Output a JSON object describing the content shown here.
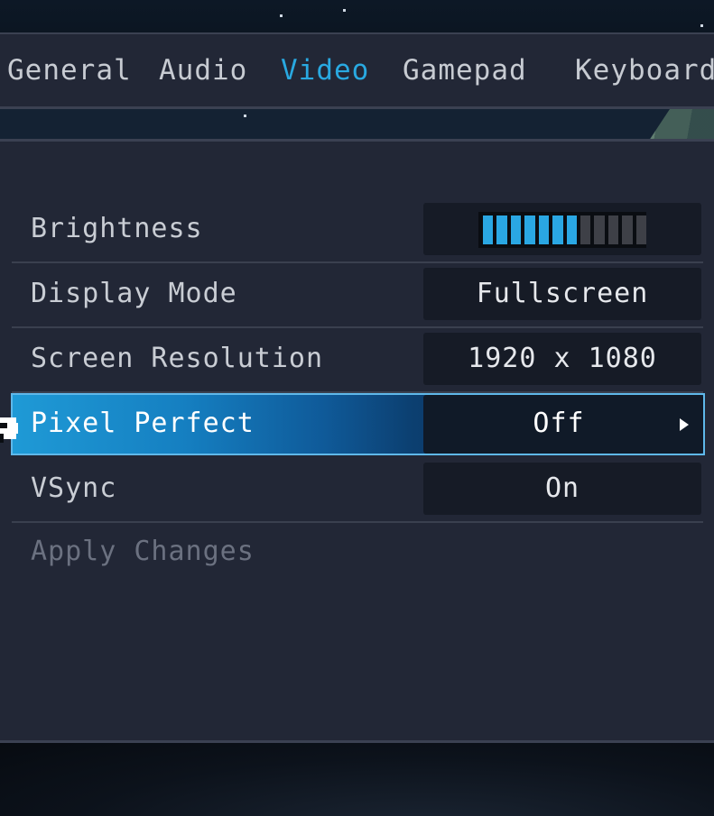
{
  "tabs": [
    {
      "label": "General",
      "active": false
    },
    {
      "label": "Audio",
      "active": false
    },
    {
      "label": "Video",
      "active": true
    },
    {
      "label": "Gamepad",
      "active": false
    },
    {
      "label": "Keyboard",
      "active": false
    }
  ],
  "settings": {
    "brightness": {
      "label": "Brightness",
      "level": 7,
      "max": 12
    },
    "display_mode": {
      "label": "Display Mode",
      "value": "Fullscreen"
    },
    "screen_resolution": {
      "label": "Screen Resolution",
      "value": "1920 x 1080"
    },
    "pixel_perfect": {
      "label": "Pixel Perfect",
      "value": "Off",
      "selected": true
    },
    "vsync": {
      "label": "VSync",
      "value": "On"
    }
  },
  "apply_label": "Apply Changes",
  "colors": {
    "accent": "#29a9e1",
    "panel": "#222736",
    "value_box": "#161b26",
    "meter_on": "#2aa7e3",
    "meter_off": "#3e4047",
    "disabled_text": "#6b7180"
  },
  "icons": {
    "pointer": "pointing-hand-icon",
    "selector": "triangle-right-icon"
  }
}
